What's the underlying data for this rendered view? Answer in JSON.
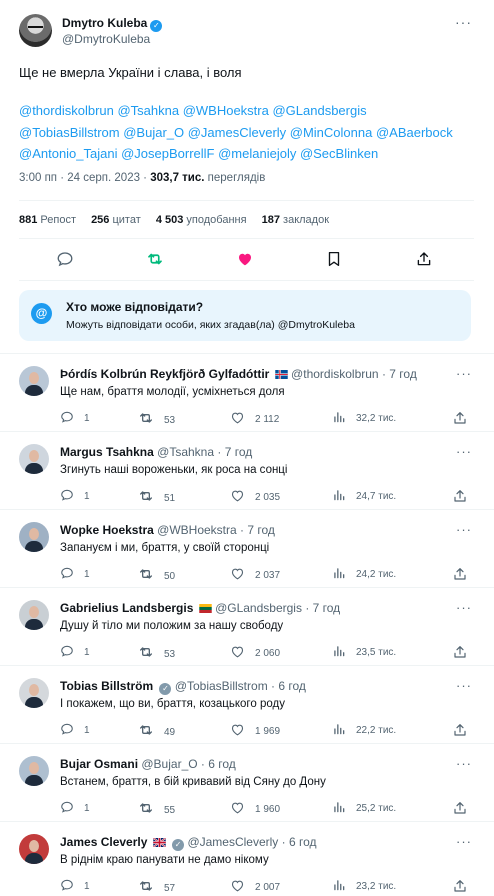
{
  "tweet": {
    "author_name": "Dmytro Kuleba",
    "author_handle": "@DmytroKuleba",
    "text": "Ще не вмерла України і слава, і воля",
    "mentions_line1": "@thordiskolbrun @Tsahkna @WBHoekstra @GLandsbergis",
    "mentions_line2": "@TobiasBillstrom @Bujar_O @JamesCleverly @MinColonna @ABaerbock",
    "mentions_line3": "@Antonio_Tajani @JosepBorrellF @melaniejoly @SecBlinken",
    "time": "3:00 пп · 24 серп. 2023 · ",
    "views_count": "303,7 тис.",
    "views_label": " переглядів"
  },
  "stats": {
    "reposts_num": "881",
    "reposts_label": " Репост",
    "quotes_num": "256",
    "quotes_label": " цитат",
    "likes_num": "4 503",
    "likes_label": " уподобання",
    "bookmarks_num": "187",
    "bookmarks_label": " закладок"
  },
  "reply_restriction": {
    "icon": "@",
    "title": "Хто може відповідати?",
    "subtitle": "Можуть відповідати особи, яких згадав(ла) @DmytroKuleba"
  },
  "colors": {
    "accent": "#1d9bf0",
    "repost_green": "#00ba7c",
    "like_pink": "#f91880",
    "muted": "#536471"
  },
  "replies": [
    {
      "name": "Þórdís Kolbrún Reykfjörð Gylfadóttir",
      "handle": "@thordiskolbrun",
      "time": "· 7 год",
      "text": "Ще нам, браття молодії, усміхнеться доля",
      "replies": "1",
      "reposts": "53",
      "likes": "2 112",
      "views": "32,2 тис."
    },
    {
      "name": "Margus Tsahkna",
      "handle": "@Tsahkna",
      "time": "· 7 год",
      "text": "Згинуть наші вороженьки, як роса на сонці",
      "replies": "1",
      "reposts": "51",
      "likes": "2 035",
      "views": "24,7 тис."
    },
    {
      "name": "Wopke Hoekstra",
      "handle": "@WBHoekstra",
      "time": "· 7 год",
      "text": "Запануєм і ми, браття, у своїй сторонці",
      "replies": "1",
      "reposts": "50",
      "likes": "2 037",
      "views": "24,2 тис."
    },
    {
      "name": "Gabrielius Landsbergis",
      "handle": "@GLandsbergis",
      "time": "· 7 год",
      "text": "Душу й тіло ми положим за нашу свободу",
      "replies": "1",
      "reposts": "53",
      "likes": "2 060",
      "views": "23,5 тис."
    },
    {
      "name": "Tobias Billström",
      "handle": "@TobiasBillstrom",
      "time": "· 6 год",
      "text": "І покажем, що ви, браття, козацького роду",
      "replies": "1",
      "reposts": "49",
      "likes": "1 969",
      "views": "22,2 тис."
    },
    {
      "name": "Bujar Osmani",
      "handle": "@Bujar_O",
      "time": "· 6 год",
      "text": "Встанем, браття, в бій кривавий від Сяну до Дону",
      "replies": "1",
      "reposts": "55",
      "likes": "1 960",
      "views": "25,2 тис."
    },
    {
      "name": "James Cleverly",
      "handle": "@JamesCleverly",
      "time": "· 6 год",
      "text": "В ріднім краю панувати не дамо нікому",
      "replies": "1",
      "reposts": "57",
      "likes": "2 007",
      "views": "23,2 тис."
    }
  ]
}
